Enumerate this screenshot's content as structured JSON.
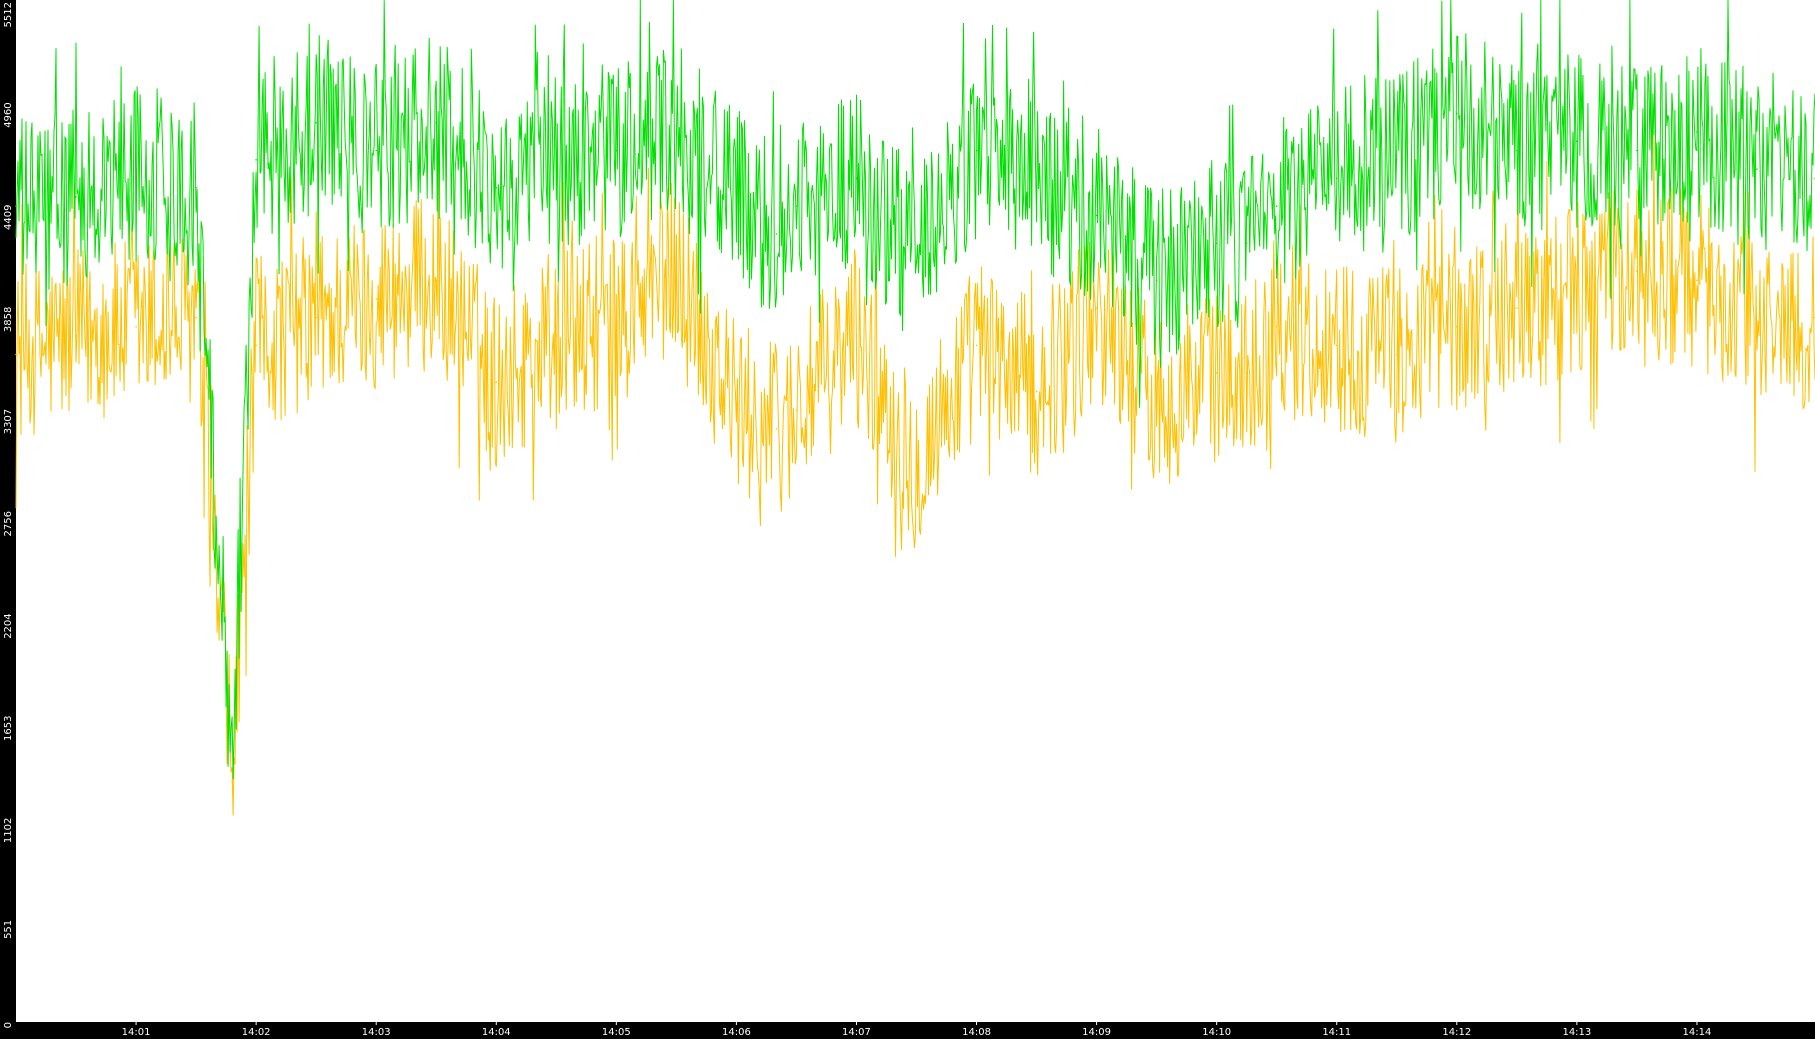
{
  "chart_data": {
    "type": "line",
    "title": "",
    "xlabel": "",
    "ylabel": "",
    "ylim": [
      0,
      5512
    ],
    "xlim": [
      "14:00:00",
      "14:14:59"
    ],
    "grid": false,
    "background_colors": {
      "frame": "#000000",
      "plot": "#ffffff",
      "text": "#ffffff"
    },
    "y_ticks": [
      "0",
      "551",
      "1102",
      "1653",
      "2204",
      "2756",
      "3307",
      "3858",
      "4409",
      "4960",
      "5512"
    ],
    "x_ticks": [
      {
        "time": "14:01:00",
        "label": "14:01"
      },
      {
        "time": "14:02:00",
        "label": "14:02"
      },
      {
        "time": "14:03:00",
        "label": "14:03"
      },
      {
        "time": "14:04:00",
        "label": "14:04"
      },
      {
        "time": "14:05:00",
        "label": "14:05"
      },
      {
        "time": "14:06:00",
        "label": "14:06"
      },
      {
        "time": "14:07:00",
        "label": "14:07"
      },
      {
        "time": "14:08:00",
        "label": "14:08"
      },
      {
        "time": "14:09:00",
        "label": "14:09"
      },
      {
        "time": "14:10:00",
        "label": "14:10"
      },
      {
        "time": "14:11:00",
        "label": "14:11"
      },
      {
        "time": "14:12:00",
        "label": "14:12"
      },
      {
        "time": "14:13:00",
        "label": "14:13"
      },
      {
        "time": "14:14:00",
        "label": "14:14"
      }
    ],
    "series": [
      {
        "color": "#ffc000",
        "x": [
          "14:00:00",
          "14:00:30",
          "14:01:00",
          "14:01:30",
          "14:01:48",
          "14:02:00",
          "14:02:30",
          "14:03:00",
          "14:03:30",
          "14:04:00",
          "14:04:30",
          "14:05:00",
          "14:05:30",
          "14:06:00",
          "14:06:20",
          "14:06:30",
          "14:07:00",
          "14:07:30",
          "14:08:00",
          "14:08:30",
          "14:09:00",
          "14:09:30",
          "14:10:00",
          "14:10:15",
          "14:10:30",
          "14:11:00",
          "14:11:30",
          "14:12:00",
          "14:12:30",
          "14:13:00",
          "14:13:30",
          "14:14:00",
          "14:14:30",
          "14:14:59"
        ],
        "values": [
          3600,
          3700,
          3750,
          3800,
          1300,
          3650,
          3800,
          3900,
          4000,
          3450,
          3700,
          3750,
          4100,
          3300,
          3200,
          3300,
          3700,
          3000,
          3650,
          3400,
          3850,
          3350,
          3500,
          3500,
          3750,
          3650,
          3600,
          3750,
          3850,
          3950,
          4050,
          4000,
          3750,
          3800
        ]
      },
      {
        "color": "#00e000",
        "x": [
          "14:00:00",
          "14:00:30",
          "14:01:00",
          "14:01:30",
          "14:01:48",
          "14:02:00",
          "14:02:30",
          "14:03:00",
          "14:03:30",
          "14:04:00",
          "14:04:30",
          "14:05:00",
          "14:05:30",
          "14:06:00",
          "14:06:20",
          "14:06:30",
          "14:07:00",
          "14:07:30",
          "14:08:00",
          "14:08:30",
          "14:09:00",
          "14:09:30",
          "14:10:00",
          "14:10:15",
          "14:10:30",
          "14:11:00",
          "14:11:30",
          "14:12:00",
          "14:12:30",
          "14:13:00",
          "14:13:30",
          "14:14:00",
          "14:14:30",
          "14:14:59"
        ],
        "values": [
          4400,
          4450,
          4600,
          4500,
          1500,
          4650,
          4850,
          4700,
          4850,
          4500,
          4650,
          4700,
          4800,
          4450,
          4250,
          4400,
          4550,
          4100,
          4700,
          4500,
          4350,
          4000,
          4200,
          4200,
          4400,
          4550,
          4650,
          4900,
          4700,
          4750,
          4700,
          4800,
          4600,
          4550
        ]
      }
    ]
  }
}
